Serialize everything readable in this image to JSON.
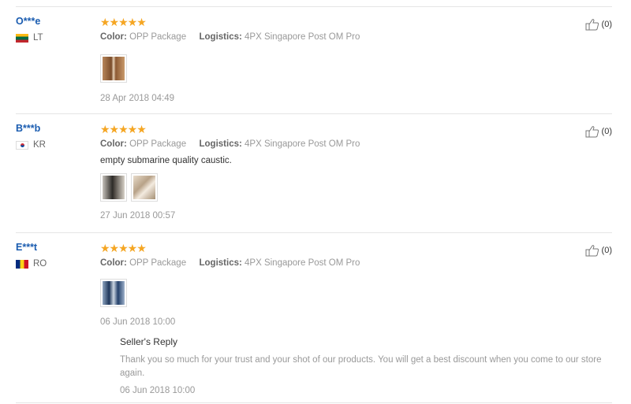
{
  "reviews": [
    {
      "user": "O***e",
      "country": "LT",
      "rating": "★★★★★",
      "color_label": "Color:",
      "color_value": "OPP Package",
      "logistics_label": "Logistics:",
      "logistics_value": "4PX Singapore Post OM Pro",
      "date": "28 Apr 2018 04:49",
      "helpful": "(0)"
    },
    {
      "user": "B***b",
      "country": "KR",
      "rating": "★★★★★",
      "color_label": "Color:",
      "color_value": "OPP Package",
      "logistics_label": "Logistics:",
      "logistics_value": "4PX Singapore Post OM Pro",
      "comment": "empty submarine quality caustic.",
      "date": "27 Jun 2018 00:57",
      "helpful": "(0)"
    },
    {
      "user": "E***t",
      "country": "RO",
      "rating": "★★★★★",
      "color_label": "Color:",
      "color_value": "OPP Package",
      "logistics_label": "Logistics:",
      "logistics_value": "4PX Singapore Post OM Pro",
      "date": "06 Jun 2018 10:00",
      "helpful": "(0)",
      "seller_reply": {
        "title": "Seller's Reply",
        "text": "Thank you so much for your trust and your shot of our products. You will get a best discount when you come to our store again.",
        "date": "06 Jun 2018 10:00"
      }
    }
  ],
  "icons": {
    "helpful": "thumbs-up-icon",
    "rating": "star-icon"
  },
  "colors": {
    "star": "#f5a623",
    "username": "#1a5cb0",
    "muted": "#999999",
    "divider": "#e5e5e5"
  }
}
